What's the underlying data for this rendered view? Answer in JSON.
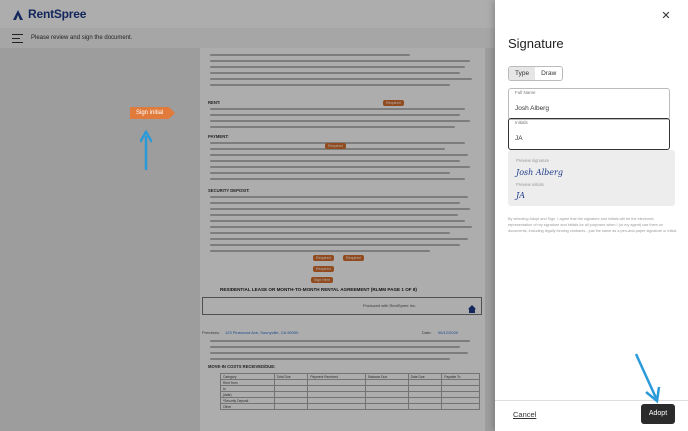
{
  "app": {
    "brand": "RentSpree",
    "instruction": "Please review and sign the document."
  },
  "document": {
    "title": "RESIDENTIAL LEASE OR MONTH-TO-MONTH RENTAL AGREEMENT (RLMM PAGE 1 OF 8)",
    "section_rent": "RENT:",
    "section_payment": "PAYMENT:",
    "section_deposit": "SECURITY DEPOSIT:",
    "section_movein": "MOVE-IN COSTS RECEIVED/DUE:",
    "premises_label": "Premises:",
    "premises_value": "123 Pinewood Ave, Sunnyville, CA 90000",
    "date_label": "Date:",
    "date_value": "06/12/2020",
    "footer_text": "Produced with RentSpree Inc.",
    "initial_tags": [
      "Required",
      "Required",
      "Required",
      "Required",
      "Required",
      "Sign Here"
    ],
    "table_headers": [
      "Category",
      "Total Due",
      "Payment Received",
      "Balance Due",
      "Date Due",
      "Payable To"
    ],
    "table_rows": [
      "Rent from",
      "to",
      "(date)",
      "*Security Deposit",
      "Other"
    ]
  },
  "overlay": {
    "sign_initial_label": "Sign initial"
  },
  "panel": {
    "title": "Signature",
    "tabs": [
      "Type",
      "Draw"
    ],
    "active_tab": "Type",
    "full_name_label": "Full Name",
    "full_name_value": "Josh Alberg",
    "initials_label": "Initials",
    "initials_value": "JA",
    "preview_signature_label": "Preview signature",
    "preview_signature_value": "Josh Alberg",
    "preview_initials_label": "Preview initials",
    "preview_initials_value": "JA",
    "disclaimer": "By selecting Adopt and Sign, I agree that the signature and initials will be the electronic representation of my signature and initials for all purposes when I (or my agent) use them on documents, including legally binding contracts - just the same as a pen-and-paper signature or initial.",
    "cancel_label": "Cancel",
    "adopt_label": "Adopt"
  },
  "colors": {
    "accent": "#e07b3c",
    "brand": "#1d3a8a",
    "arrow": "#2b9ad8",
    "adopt_bg": "#2b2b2b"
  }
}
